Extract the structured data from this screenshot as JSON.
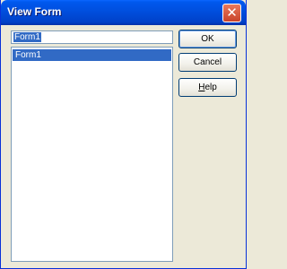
{
  "window": {
    "title": "View Form",
    "close_glyph": "✕"
  },
  "form_name_field": {
    "value": "Form1"
  },
  "forms_list": {
    "items": [
      "Form1"
    ],
    "selected": "Form1"
  },
  "buttons": {
    "ok": "OK",
    "cancel": "Cancel",
    "help_prefix": "",
    "help_mnemonic": "H",
    "help_rest": "elp"
  },
  "colors": {
    "title_bar": "#0050e0",
    "selection": "#316ac5",
    "face": "#ece9d8",
    "close": "#c9432a"
  },
  "icons": {
    "close": "close-icon"
  }
}
